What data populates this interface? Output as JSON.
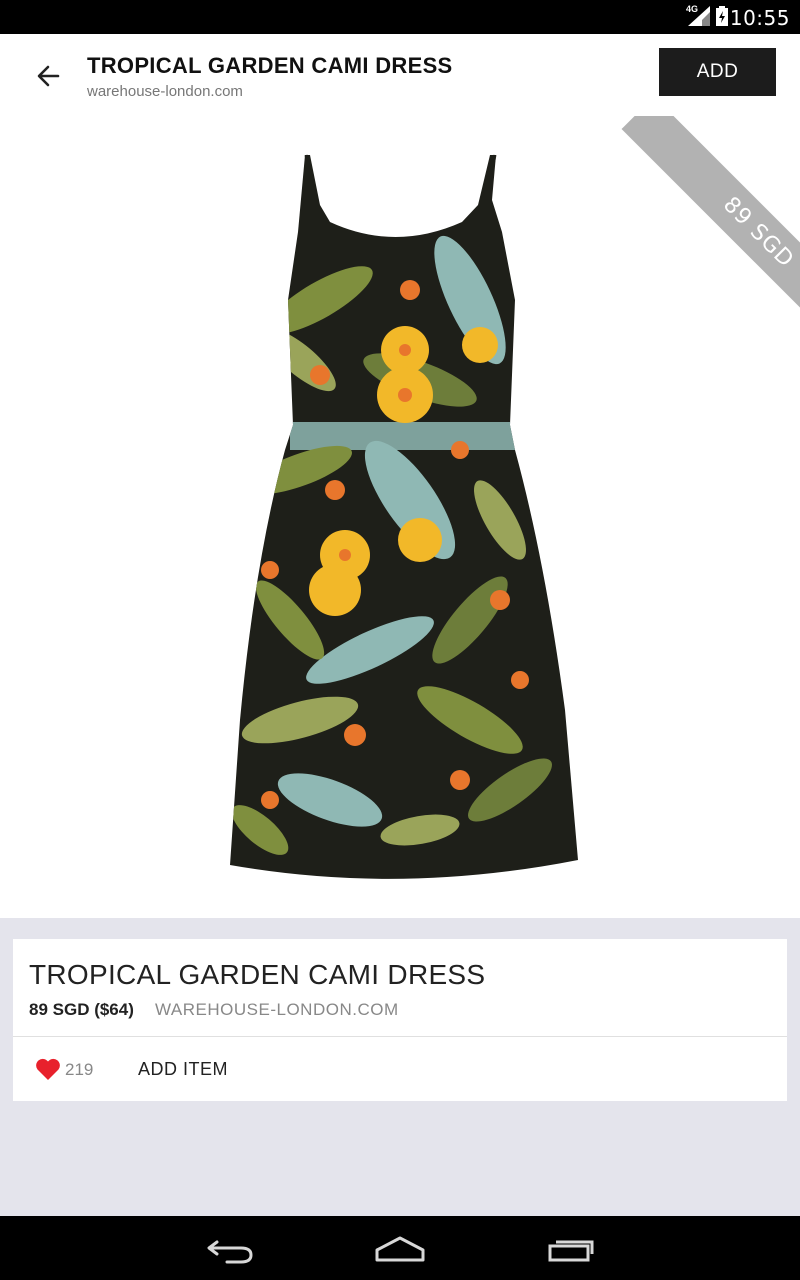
{
  "status_bar": {
    "time": "10:55",
    "network": "4G"
  },
  "app_bar": {
    "title": "TROPICAL GARDEN CAMI DRESS",
    "subtitle": "warehouse-london.com",
    "add_label": "ADD"
  },
  "hero": {
    "price_ribbon": "89 SGD"
  },
  "product": {
    "title": "TROPICAL GARDEN CAMI DRESS",
    "price": "89 SGD ($64)",
    "store": "WAREHOUSE-LONDON.COM",
    "likes": "219",
    "add_item_label": "ADD ITEM"
  },
  "colors": {
    "dress_base": "#1e1f19",
    "leaf_green": "#7f8f3e",
    "leaf_teal": "#8fb8b4",
    "flower_yellow": "#f2b829",
    "flower_orange": "#e8762c",
    "heart": "#e8212c"
  }
}
